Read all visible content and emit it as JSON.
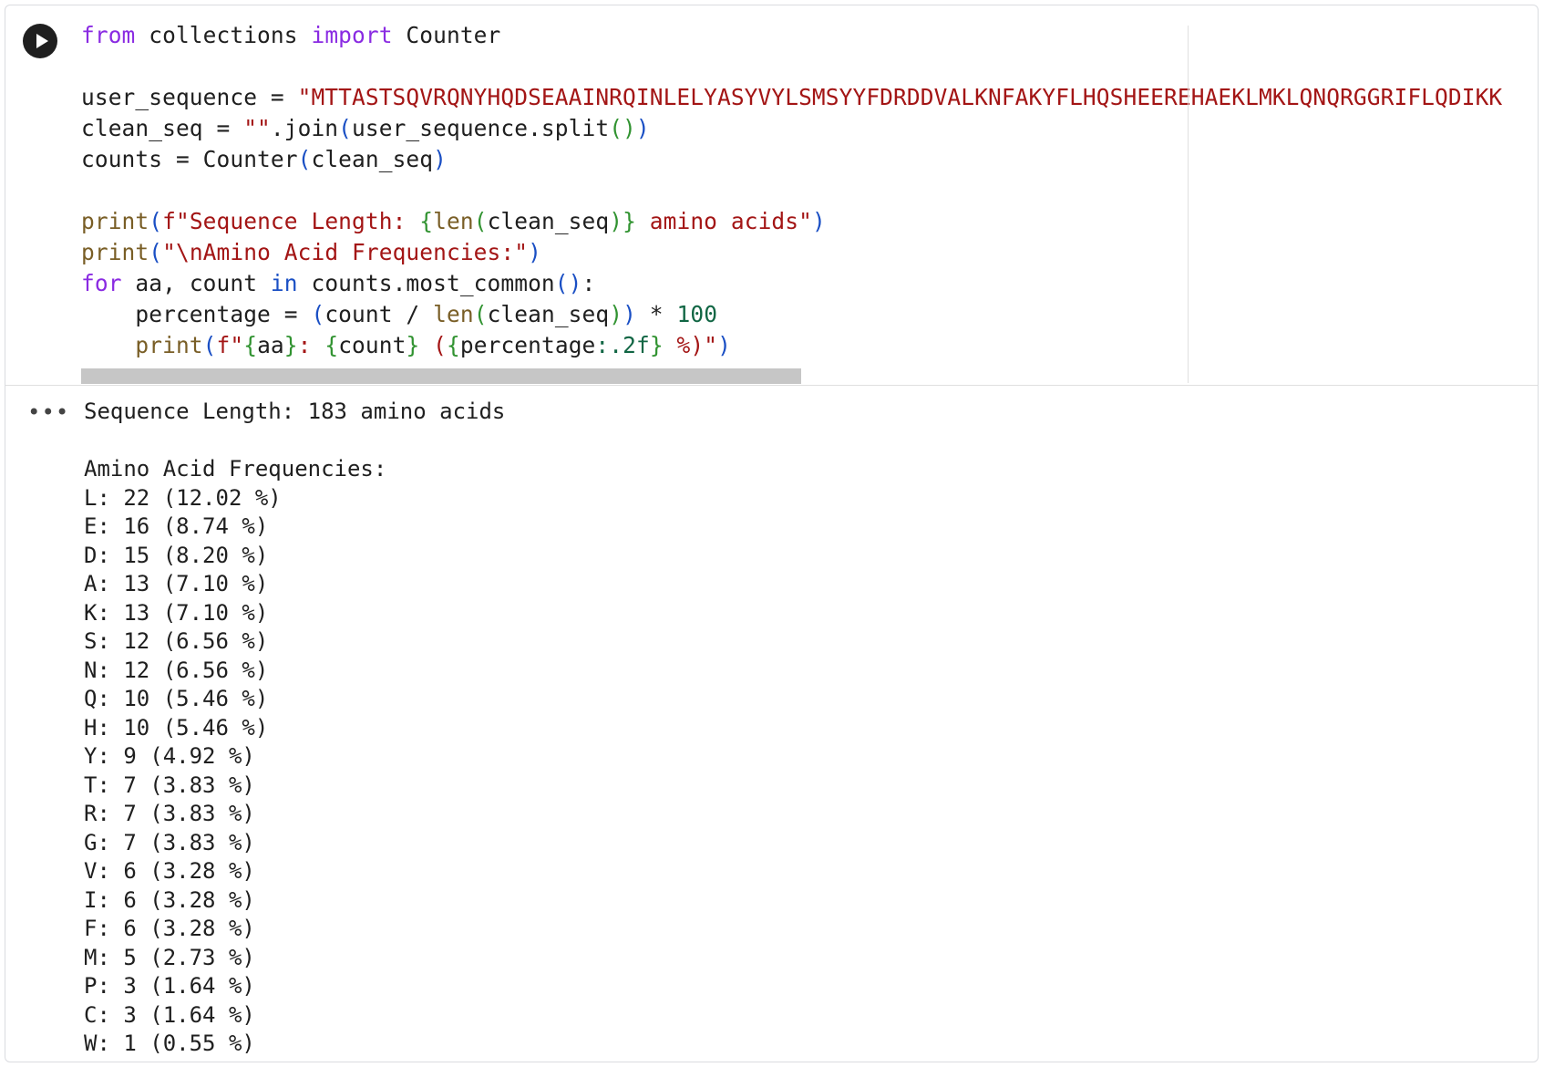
{
  "code": {
    "import_from": "from",
    "module": " collections ",
    "import_kw": "import",
    "import_name": " Counter",
    "l3_var": "user_sequence = ",
    "l3_str": "\"MTTASTSQVRQNYHQDSEAAINRQINLELYASYVYLSMSYYFDRDDVALKNFAKYFLHQSHEEREHAEKLMKLQNQRGGRIFLQDIKK",
    "l4_var": "clean_seq = ",
    "l4_str": "\"\"",
    "l4_join": ".join",
    "l4_arg": "user_sequence.split",
    "l5_var": "counts = Counter",
    "l5_arg": "clean_seq",
    "l7_print": "print",
    "l7_str1": "f\"Sequence Length: ",
    "l7_len": "len",
    "l7_arg": "clean_seq",
    "l7_str2": " amino acids\"",
    "l8_print": "print",
    "l8_str": "\"\\nAmino Acid Frequencies:\"",
    "l9_for": "for",
    "l9_vars": " aa, count ",
    "l9_in": "in",
    "l9_call": " counts.most_common",
    "l10_var": "    percentage = ",
    "l10_a": "count / ",
    "l10_len": "len",
    "l10_b": "clean_seq",
    "l10_op": " * ",
    "l10_num": "100",
    "l11_print": "    print",
    "l11_f": "f\"",
    "l11_aa": "aa",
    "l11_colon": ": ",
    "l11_count": "count",
    "l11_pct": "percentage",
    "l11_fmt": ":.2f",
    "l11_tail": " %)\""
  },
  "output": {
    "menu_icon": "•••",
    "lines": [
      "Sequence Length: 183 amino acids",
      "",
      "Amino Acid Frequencies:",
      "L: 22 (12.02 %)",
      "E: 16 (8.74 %)",
      "D: 15 (8.20 %)",
      "A: 13 (7.10 %)",
      "K: 13 (7.10 %)",
      "S: 12 (6.56 %)",
      "N: 12 (6.56 %)",
      "Q: 10 (5.46 %)",
      "H: 10 (5.46 %)",
      "Y: 9 (4.92 %)",
      "T: 7 (3.83 %)",
      "R: 7 (3.83 %)",
      "G: 7 (3.83 %)",
      "V: 6 (3.28 %)",
      "I: 6 (3.28 %)",
      "F: 6 (3.28 %)",
      "M: 5 (2.73 %)",
      "P: 3 (1.64 %)",
      "C: 3 (1.64 %)",
      "W: 1 (0.55 %)"
    ]
  }
}
